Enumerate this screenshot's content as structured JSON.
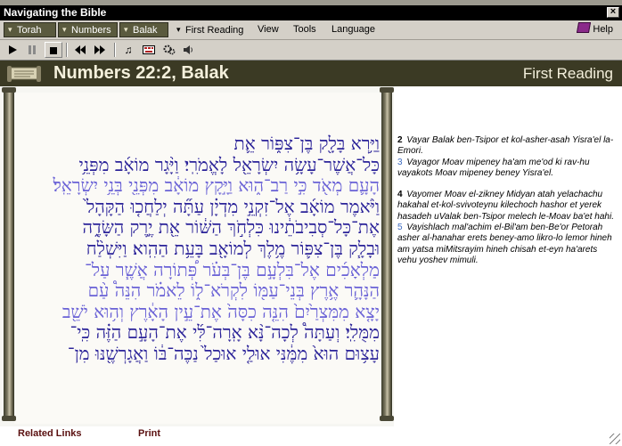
{
  "window": {
    "title": "Navigating the Bible"
  },
  "menubar": {
    "torah": "Torah",
    "numbers": "Numbers",
    "balak": "Balak",
    "first_reading": "First Reading",
    "view": "View",
    "tools": "Tools",
    "language": "Language",
    "help": "Help"
  },
  "toolbar": {
    "icons": [
      "play-icon",
      "pause-icon",
      "stop-icon",
      "rewind-icon",
      "fast-forward-icon",
      "music-note-icon",
      "hebrew-keyboard-icon",
      "settings-icon",
      "speaker-icon"
    ]
  },
  "header": {
    "reference": "Numbers 22:2, Balak",
    "reading": "First Reading"
  },
  "hebrew": {
    "lines": [
      "וַיַּ֥רְא בָּלָ֖ק בֶּן־צִפּ֑וֹר אֵ֛ת",
      "כָּל־אֲשֶׁר־עָשָׂ֥ה יִשְׂרָאֵ֖ל לָאֱמֹרִֽי׃ וַיָּ֨גָר מוֹאָ֜ב מִפְּנֵ֥י",
      "הָעָ֛ם מְאֹ֖ד כִּ֣י רַב־ה֑וּא וַיָּ֣קָץ מוֹאָ֔ב מִפְּנֵ֖י בְּנֵ֥י יִשְׂרָאֵֽל׃",
      "וַיֹּ֨אמֶר מוֹאָ֜ב אֶל־זִקְנֵ֣י מִדְיָ֗ן עַתָּ֞ה יְלַחֲכ֤וּ הַקָּהָל֙",
      "אֶת־כָּל־סְבִיבֹתֵ֔ינוּ כִּלְחֹ֣ךְ הַשּׁ֔וֹר אֵ֖ת יֶ֣רֶק הַשָּׂדֶ֑ה",
      "וּבָלָ֧ק בֶּן־צִפּ֛וֹר מֶ֥לֶךְ לְמוֹאָ֖ב בָּעֵ֥ת הַהִֽוא׃ וַיִּשְׁלַ֨ח",
      "מַלְאָכִ֜ים אֶל־בִּלְעָ֣ם בֶּן־בְּעֹ֗ר פְּ֠תוֹרָה אֲשֶׁ֧ר עַל־",
      "הַנָּהָ֛ר אֶ֥רֶץ בְּנֵי־עַמּ֖וֹ לִקְרֹא־ל֑וֹ לֵאמֹ֗ר הִנֵּה֩ עַ֨ם",
      "יָצָ֤א מִמִּצְרַ֙יִם֙ הִנֵּ֤ה כִסָּה֙ אֶת־עֵ֣ין הָאָ֔רֶץ וְה֥וּא יֹשֵׁ֖ב",
      "מִמֻּלִֽי׃ וְעַתָּה֩ לְכָה־נָּ֨א אָֽרָה־לִּ֜י אֶת־הָעָ֣ם הַזֶּ֗ה כִּֽי־",
      "עָצ֥וּם הוּא֙ מִמֶּ֔נִּי אוּלַ֤י אוּכַל֙ נַכֶּה־בּ֔וֹ וַאֲגָרְשֶׁ֖נּוּ מִן־"
    ]
  },
  "transliteration": {
    "verses": [
      {
        "num": "2",
        "text": "Vayar Balak ben-Tsipor et kol-asher-asah Yisra'el la-Emori."
      },
      {
        "num": "3",
        "text": "Vayagor Moav mipeney ha'am me'od ki rav-hu vayakots Moav mipeney beney Yisra'el."
      },
      {
        "num": "4",
        "text": "Vayomer Moav el-zikney Midyan atah yelachachu hakahal et-kol-svivoteynu kilechoch hashor et yerek hasadeh uValak ben-Tsipor melech le-Moav ba'et hahi."
      },
      {
        "num": "5",
        "text": "Vayishlach mal'achim el-Bil'am ben-Be'or Petorah asher al-hanahar erets beney-amo likro-lo lemor hineh am yatsa miMitsrayim hineh chisah et-eyn ha'arets vehu yoshev mimuli."
      }
    ]
  },
  "footer": {
    "related_links": "Related Links",
    "print": "Print"
  }
}
